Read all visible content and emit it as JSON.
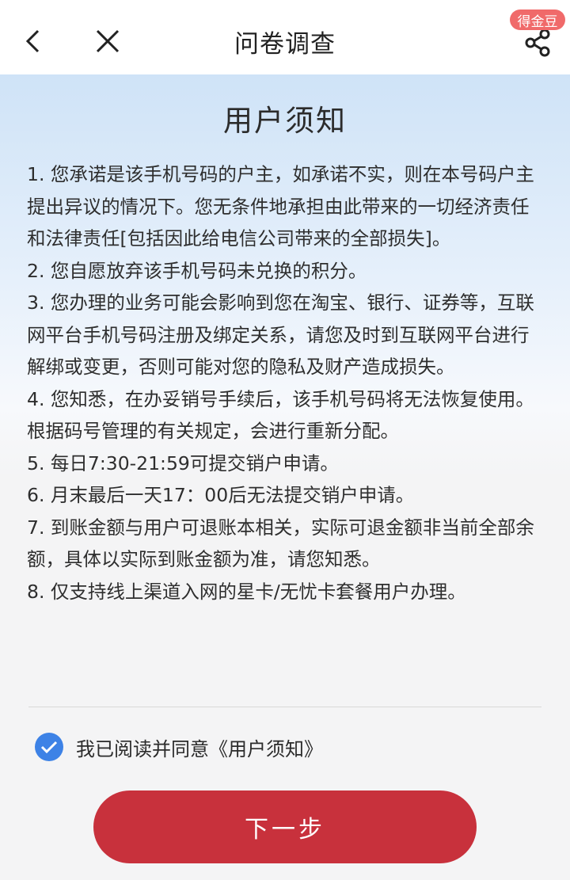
{
  "header": {
    "title": "问卷调查",
    "badge": "得金豆",
    "back_icon": "chevron-left-icon",
    "close_icon": "close-icon",
    "share_icon": "share-icon"
  },
  "notice": {
    "title": "用户须知",
    "items": [
      "1. 您承诺是该手机号码的户主，如承诺不实，则在本号码户主提出异议的情况下。您无条件地承担由此带来的一切经济责任和法律责任[包括因此给电信公司带来的全部损失]。",
      "2. 您自愿放弃该手机号码未兑换的积分。",
      "3. 您办理的业务可能会影响到您在淘宝、银行、证券等，互联网平台手机号码注册及绑定关系，请您及时到互联网平台进行解绑或变更，否则可能对您的隐私及财产造成损失。",
      "4. 您知悉，在办妥销号手续后，该手机号码将无法恢复使用。根据码号管理的有关规定，会进行重新分配。",
      "5. 每日7:30-21:59可提交销户申请。",
      "6. 月末最后一天17：00后无法提交销户申请。",
      "7. 到账金额与用户可退账本相关，实际可退金额非当前全部余额，具体以实际到账金额为准，请您知悉。",
      "8. 仅支持线上渠道入网的星卡/无忧卡套餐用户办理。"
    ]
  },
  "agreement": {
    "checked": true,
    "label": "我已阅读并同意《用户须知》"
  },
  "next_button": {
    "label": "下一步"
  },
  "colors": {
    "accent": "#c8313c",
    "check": "#3d82e6",
    "badge": "#f06a6a"
  }
}
